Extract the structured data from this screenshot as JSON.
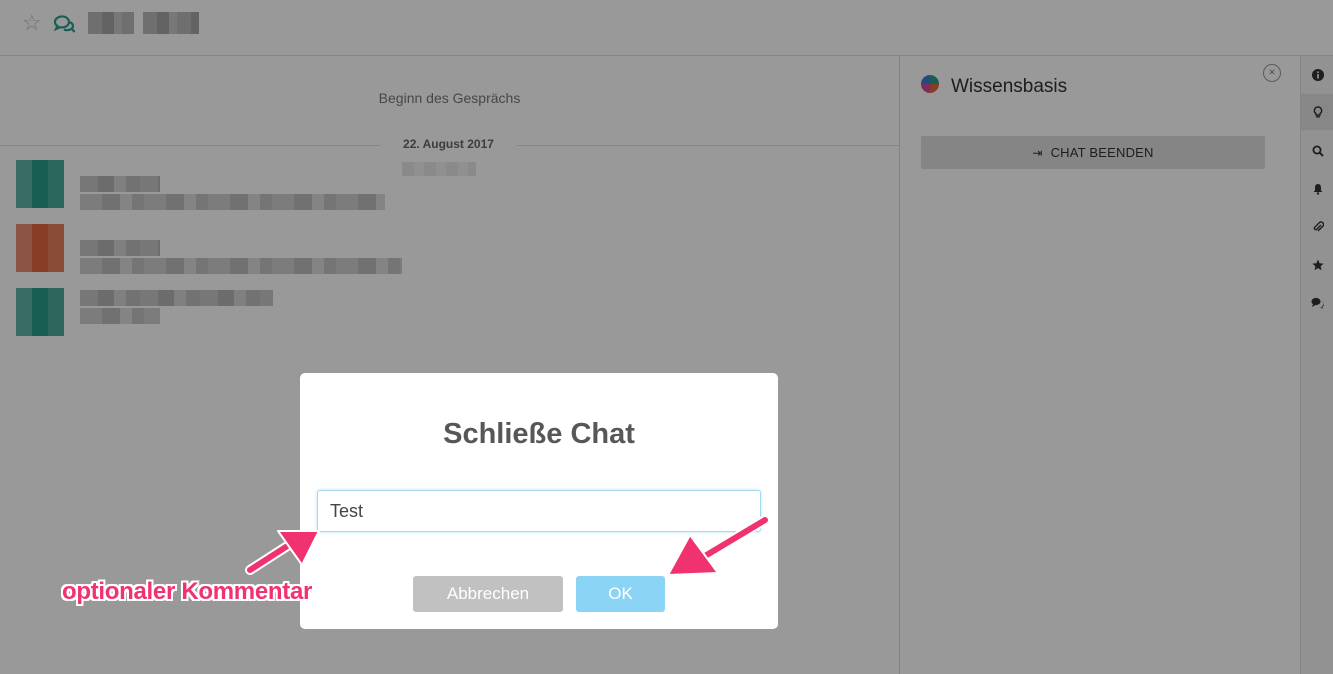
{
  "header": {
    "star_icon": "star-outline-icon",
    "chat_icon": "chat-bubbles-icon",
    "contact_name_redacted": true
  },
  "messages": {
    "start_label": "Beginn des Gesprächs",
    "date_label": "22. August 2017"
  },
  "sidebar": {
    "title": "Wissensbasis",
    "end_chat_label": "CHAT BEENDEN",
    "end_chat_icon": "sign-out-icon"
  },
  "rail": {
    "icons": [
      "info-icon",
      "lightbulb-icon",
      "search-icon",
      "bell-icon",
      "paperclip-icon",
      "star-icon",
      "comments-icon"
    ]
  },
  "dialog": {
    "title": "Schließe Chat",
    "comment_value": "Test",
    "cancel_label": "Abbrechen",
    "ok_label": "OK"
  },
  "annotation": {
    "label": "optionaler Kommentar",
    "color": "#f0336e"
  },
  "colors": {
    "accent_green": "#2a9d8a",
    "ok_button": "#8cd4f5",
    "cancel_button": "#c1c1c1"
  }
}
